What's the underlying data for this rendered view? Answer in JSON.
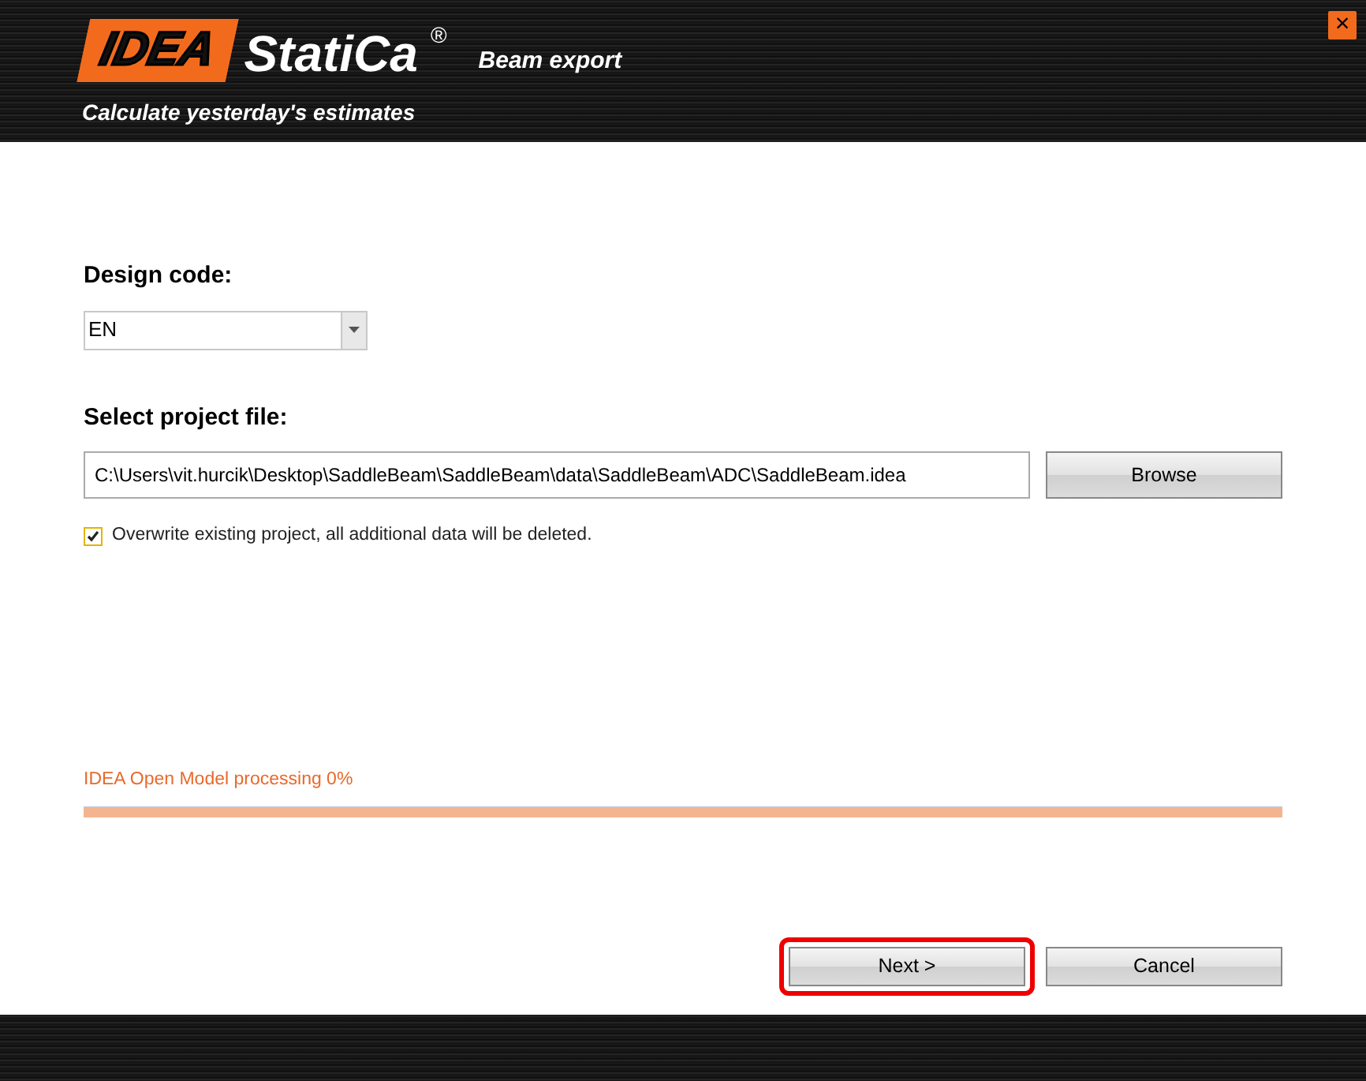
{
  "header": {
    "logo_mark": "IDEA",
    "logo_text": "StatiCa",
    "logo_registered": "®",
    "product": "Beam export",
    "tagline": "Calculate yesterday's estimates",
    "close": "×"
  },
  "design_code": {
    "label": "Design code:",
    "value": "EN"
  },
  "project_file": {
    "label": "Select project file:",
    "value": "C:\\Users\\vit.hurcik\\Desktop\\SaddleBeam\\SaddleBeam\\data\\SaddleBeam\\ADC\\SaddleBeam.idea",
    "browse": "Browse"
  },
  "overwrite": {
    "label": "Overwrite existing project, all additional data will be deleted.",
    "checked": true
  },
  "progress": {
    "label": "IDEA Open Model processing 0%"
  },
  "buttons": [
    {
      "label": "Next >",
      "highlighted": true
    },
    {
      "label": "Cancel",
      "highlighted": false
    }
  ]
}
